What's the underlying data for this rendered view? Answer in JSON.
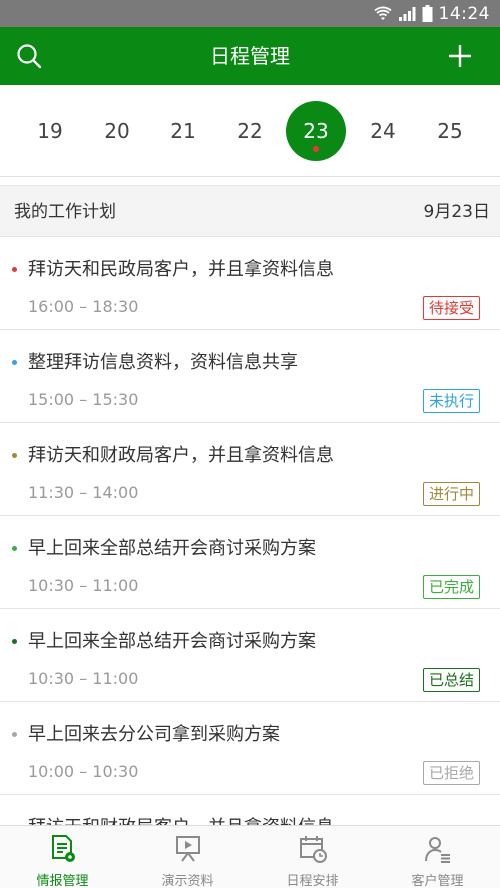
{
  "status_bar": {
    "time": "14:24"
  },
  "header": {
    "title": "日程管理"
  },
  "date_strip": {
    "dates": [
      "19",
      "20",
      "21",
      "22",
      "23",
      "24",
      "25"
    ],
    "selected_index": 4
  },
  "section": {
    "title": "我的工作计划",
    "date": "9月23日"
  },
  "tasks": [
    {
      "title": "拜访天和民政局客户，并且拿资料信息",
      "time": "16:00 – 18:30",
      "status": "待接受",
      "color": "#e53935"
    },
    {
      "title": "整理拜访信息资料，资料信息共享",
      "time": "15:00 – 15:30",
      "status": "未执行",
      "color": "#2fa3e6"
    },
    {
      "title": "拜访天和财政局客户，并且拿资料信息",
      "time": "11:30 – 14:00",
      "status": "进行中",
      "color": "#9c8a3c"
    },
    {
      "title": "早上回来全部总结开会商讨采购方案",
      "time": "10:30 – 11:00",
      "status": "已完成",
      "color": "#3cae3c"
    },
    {
      "title": "早上回来全部总结开会商讨采购方案",
      "time": "10:30 – 11:00",
      "status": "已总结",
      "color": "#1b6e1b"
    },
    {
      "title": "早上回来去分公司拿到采购方案",
      "time": "10:00 – 10:30",
      "status": "已拒绝",
      "color": "#a8a8a8"
    },
    {
      "title": "拜访天和财政局客户，并且拿资料信息",
      "time": "",
      "status": "",
      "color": "#9c8a3c"
    }
  ],
  "nav": [
    {
      "label": "情报管理",
      "icon": "document-gear-icon",
      "active": true
    },
    {
      "label": "演示资料",
      "icon": "presentation-icon",
      "active": false
    },
    {
      "label": "日程安排",
      "icon": "calendar-clock-icon",
      "active": false
    },
    {
      "label": "客户管理",
      "icon": "person-list-icon",
      "active": false
    }
  ],
  "colors": {
    "brand": "#0a8a14",
    "status_bar": "#7a7a7a"
  }
}
